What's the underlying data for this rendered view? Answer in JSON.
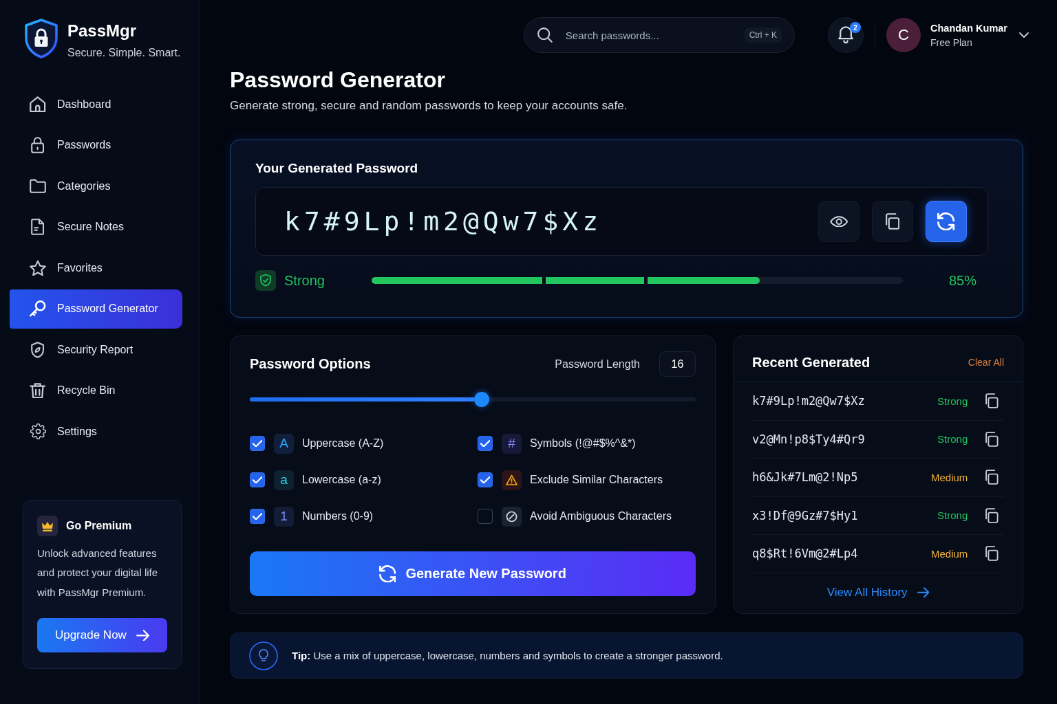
{
  "brand": {
    "name": "PassMgr",
    "tagline": "Secure. Simple. Smart."
  },
  "sidebar": {
    "items": [
      {
        "label": "Dashboard",
        "selected": false
      },
      {
        "label": "Passwords",
        "selected": false
      },
      {
        "label": "Categories",
        "selected": false
      },
      {
        "label": "Secure Notes",
        "selected": false
      },
      {
        "label": "Favorites",
        "selected": false
      },
      {
        "label": "Password Generator",
        "selected": true
      },
      {
        "label": "Security Report",
        "selected": false
      },
      {
        "label": "Recycle Bin",
        "selected": false
      },
      {
        "label": "Settings",
        "selected": false
      }
    ]
  },
  "premium": {
    "title": "Go Premium",
    "text": "Unlock advanced features and protect your digital life with PassMgr Premium.",
    "button": "Upgrade Now"
  },
  "topbar": {
    "search": {
      "placeholder": "Search passwords...",
      "shortcut": "Ctrl + K"
    },
    "notifications": {
      "count": "2"
    },
    "user": {
      "initial": "C",
      "name": "Chandan Kumar",
      "plan": "Free Plan"
    }
  },
  "header": {
    "title": "Password Generator",
    "subtitle": "Generate strong, secure and random passwords to keep your accounts safe."
  },
  "generated": {
    "title": "Your Generated Password",
    "password": "k7#9Lp!m2@Qw7$Xz",
    "strength": {
      "label": "Strong",
      "level": 0.73,
      "reading": "85%"
    }
  },
  "options": {
    "title": "Password Options",
    "length_label": "Password Length",
    "length": "16",
    "slider": {
      "level": 0.52
    },
    "items": [
      {
        "kind": "letter",
        "glyph": "A",
        "label": "Uppercase (A-Z)",
        "checked": true
      },
      {
        "kind": "letter",
        "glyph": "#",
        "label": "Symbols (!@#$%^&*)",
        "checked": true
      },
      {
        "kind": "letter",
        "glyph": "a",
        "label": "Lowercase (a-z)",
        "checked": true
      },
      {
        "kind": "icon",
        "label": "Exclude Similar Characters",
        "checked": true
      },
      {
        "kind": "letter",
        "glyph": "1",
        "label": "Numbers (0-9)",
        "checked": true
      },
      {
        "kind": "icon",
        "label": "Avoid Ambiguous Characters",
        "checked": false
      }
    ],
    "button": "Generate New Password"
  },
  "recent": {
    "title": "Recent Generated",
    "action": "Clear All",
    "rows": [
      {
        "password": "k7#9Lp!m2@Qw7$Xz",
        "strength": "Strong",
        "color": "#22c55e"
      },
      {
        "password": "v2@Mn!p8$Ty4#Qr9",
        "strength": "Strong",
        "color": "#22c55e"
      },
      {
        "password": "h6&Jk#7Lm@2!Np5",
        "strength": "Medium",
        "color": "#f5b437"
      },
      {
        "password": "x3!Df@9Gz#7$Hy1",
        "strength": "Strong",
        "color": "#22c55e"
      },
      {
        "password": "q8$Rt!6Vm@2#Lp4",
        "strength": "Medium",
        "color": "#f5b437"
      }
    ],
    "link": "View All History"
  },
  "tip": {
    "text": "**Tip:** Use a mix of uppercase, lowercase, numbers and symbols to create a stronger password."
  }
}
